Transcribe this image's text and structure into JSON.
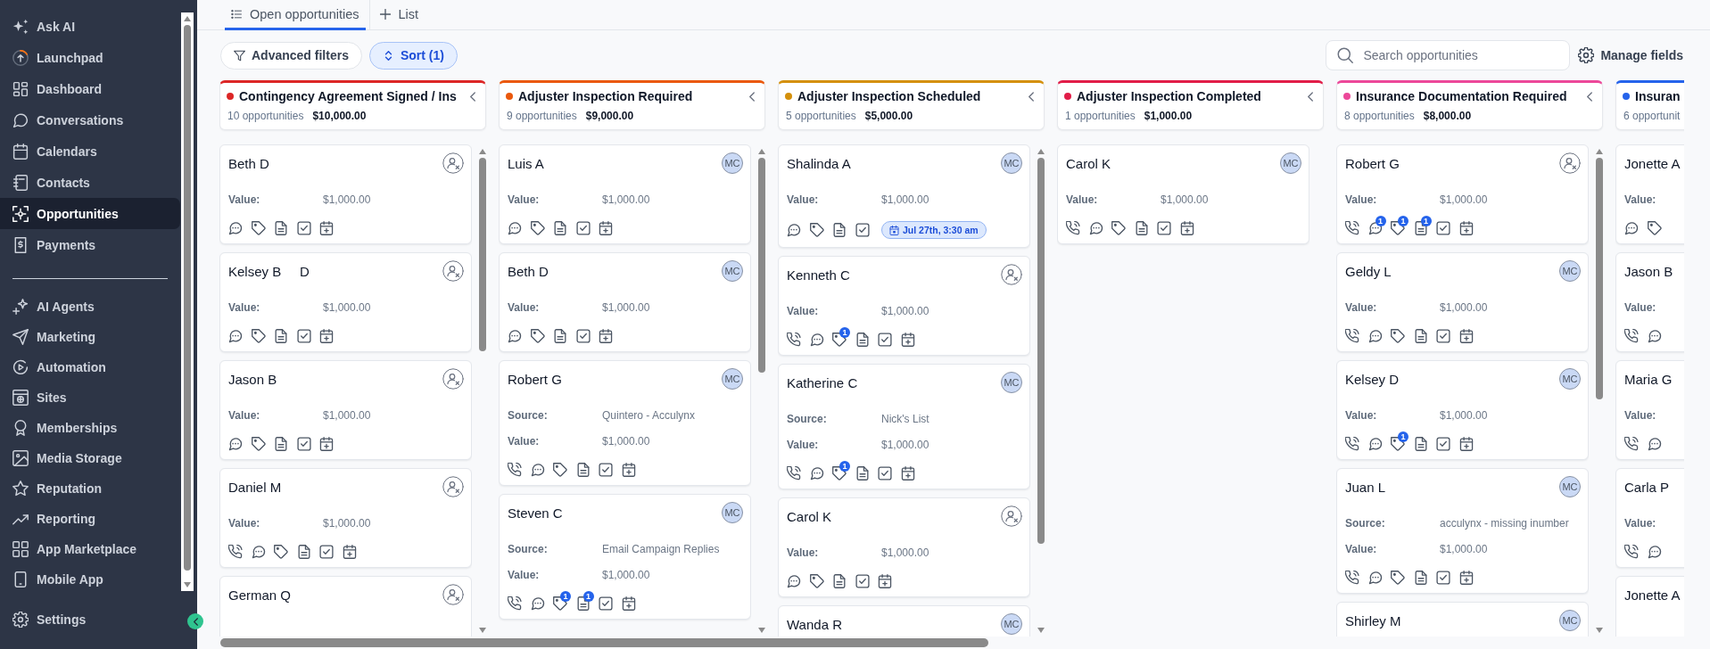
{
  "sidebar": {
    "sections": [
      {
        "items": [
          {
            "label": "Ask AI",
            "kind": "ask_ai",
            "selected": false
          },
          {
            "label": "Launchpad",
            "kind": "launchpad",
            "selected": false
          },
          {
            "label": "Dashboard",
            "kind": "dashboard",
            "selected": false
          },
          {
            "label": "Conversations",
            "kind": "conversations",
            "selected": false
          },
          {
            "label": "Calendars",
            "kind": "calendars",
            "selected": false
          },
          {
            "label": "Contacts",
            "kind": "contacts",
            "selected": false
          },
          {
            "label": "Opportunities",
            "kind": "opportunities",
            "selected": true
          },
          {
            "label": "Payments",
            "kind": "payments",
            "selected": false
          }
        ]
      },
      {
        "items": [
          {
            "label": "AI Agents",
            "kind": "ai_agents",
            "selected": false
          },
          {
            "label": "Marketing",
            "kind": "marketing",
            "selected": false
          },
          {
            "label": "Automation",
            "kind": "automation",
            "selected": false
          },
          {
            "label": "Sites",
            "kind": "sites",
            "selected": false
          },
          {
            "label": "Memberships",
            "kind": "memberships",
            "selected": false
          },
          {
            "label": "Media Storage",
            "kind": "media",
            "selected": false
          },
          {
            "label": "Reputation",
            "kind": "reputation",
            "selected": false
          },
          {
            "label": "Reporting",
            "kind": "reporting",
            "selected": false
          },
          {
            "label": "App Marketplace",
            "kind": "marketplace",
            "selected": false
          },
          {
            "label": "Mobile App",
            "kind": "mobile",
            "selected": false
          }
        ]
      }
    ],
    "footer": {
      "label": "Settings",
      "kind": "settings",
      "selected": false
    }
  },
  "tabs": [
    {
      "label": "Open opportunities",
      "kind": "list",
      "selected": true
    },
    {
      "label": "List",
      "kind": "plus",
      "selected": false
    }
  ],
  "toolbar": {
    "filters": {
      "label": "Advanced filters"
    },
    "sort": {
      "label": "Sort (1)",
      "active": true
    },
    "search": {
      "placeholder": "Search opportunities"
    },
    "manage": {
      "label": "Manage fields"
    }
  },
  "board": {
    "columns": [
      {
        "title": "Contingency Agreement Signed / Ins",
        "color": "#dc2626",
        "count": "10 opportunities",
        "total": "$10,000.00",
        "scrollable": true,
        "cards": [
          {
            "name": "Beth D",
            "owner": {
              "kind": "unassigned"
            },
            "fields": [
              {
                "label": "Value:",
                "value": "$1,000.00"
              }
            ],
            "actions": [
              {
                "kind": "chat"
              },
              {
                "kind": "tag"
              },
              {
                "kind": "note"
              },
              {
                "kind": "task"
              },
              {
                "kind": "appointment"
              }
            ]
          },
          {
            "name": "Kelsey B     D",
            "owner": {
              "kind": "unassigned"
            },
            "fields": [
              {
                "label": "Value:",
                "value": "$1,000.00"
              }
            ],
            "actions": [
              {
                "kind": "chat"
              },
              {
                "kind": "tag"
              },
              {
                "kind": "note"
              },
              {
                "kind": "task"
              },
              {
                "kind": "appointment"
              }
            ]
          },
          {
            "name": "Jason B",
            "owner": {
              "kind": "unassigned"
            },
            "fields": [
              {
                "label": "Value:",
                "value": "$1,000.00"
              }
            ],
            "actions": [
              {
                "kind": "chat"
              },
              {
                "kind": "tag"
              },
              {
                "kind": "note"
              },
              {
                "kind": "task"
              },
              {
                "kind": "appointment"
              }
            ]
          },
          {
            "name": "Daniel M",
            "owner": {
              "kind": "unassigned"
            },
            "fields": [
              {
                "label": "Value:",
                "value": "$1,000.00"
              }
            ],
            "actions": [
              {
                "kind": "call"
              },
              {
                "kind": "chat"
              },
              {
                "kind": "tag"
              },
              {
                "kind": "note"
              },
              {
                "kind": "task"
              },
              {
                "kind": "appointment"
              }
            ]
          },
          {
            "name": "German Q",
            "owner": {
              "kind": "unassigned"
            }
          }
        ]
      },
      {
        "title": "Adjuster Inspection Required",
        "color": "#ea580c",
        "count": "9 opportunities",
        "total": "$9,000.00",
        "scrollable": true,
        "cards": [
          {
            "name": "Luis A",
            "owner": {
              "kind": "initials",
              "initials": "MC"
            },
            "fields": [
              {
                "label": "Value:",
                "value": "$1,000.00"
              }
            ],
            "actions": [
              {
                "kind": "chat"
              },
              {
                "kind": "tag"
              },
              {
                "kind": "note"
              },
              {
                "kind": "task"
              },
              {
                "kind": "appointment"
              }
            ]
          },
          {
            "name": "Beth D",
            "owner": {
              "kind": "initials",
              "initials": "MC"
            },
            "fields": [
              {
                "label": "Value:",
                "value": "$1,000.00"
              }
            ],
            "actions": [
              {
                "kind": "chat"
              },
              {
                "kind": "tag"
              },
              {
                "kind": "note"
              },
              {
                "kind": "task"
              },
              {
                "kind": "appointment"
              }
            ]
          },
          {
            "name": "Robert G",
            "owner": {
              "kind": "initials",
              "initials": "MC"
            },
            "fields": [
              {
                "label": "Source:",
                "value": "Quintero - Acculynx"
              },
              {
                "label": "Value:",
                "value": "$1,000.00"
              }
            ],
            "actions": [
              {
                "kind": "call"
              },
              {
                "kind": "chat"
              },
              {
                "kind": "tag"
              },
              {
                "kind": "note"
              },
              {
                "kind": "task"
              },
              {
                "kind": "appointment"
              }
            ]
          },
          {
            "name": "Steven C",
            "owner": {
              "kind": "initials",
              "initials": "MC"
            },
            "fields": [
              {
                "label": "Source:",
                "value": "Email Campaign Replies"
              },
              {
                "label": "Value:",
                "value": "$1,000.00"
              }
            ],
            "actions": [
              {
                "kind": "call"
              },
              {
                "kind": "chat"
              },
              {
                "kind": "tag",
                "badge": "1"
              },
              {
                "kind": "note",
                "badge": "1"
              },
              {
                "kind": "task"
              },
              {
                "kind": "appointment"
              }
            ]
          }
        ]
      },
      {
        "title": "Adjuster Inspection Scheduled",
        "color": "#d4900b",
        "count": "5 opportunities",
        "total": "$5,000.00",
        "scrollable": true,
        "cards": [
          {
            "name": "Shalinda A",
            "owner": {
              "kind": "initials",
              "initials": "MC"
            },
            "fields": [
              {
                "label": "Value:",
                "value": "$1,000.00"
              }
            ],
            "actions": [
              {
                "kind": "chat"
              },
              {
                "kind": "tag"
              },
              {
                "kind": "note"
              },
              {
                "kind": "task"
              },
              {
                "kind": "appointment",
                "label": "Jul 27th, 3:30 am"
              }
            ]
          },
          {
            "name": "Kenneth C",
            "owner": {
              "kind": "unassigned"
            },
            "fields": [
              {
                "label": "Value:",
                "value": "$1,000.00"
              }
            ],
            "actions": [
              {
                "kind": "call"
              },
              {
                "kind": "chat"
              },
              {
                "kind": "tag",
                "badge": "1"
              },
              {
                "kind": "note"
              },
              {
                "kind": "task"
              },
              {
                "kind": "appointment"
              }
            ]
          },
          {
            "name": "Katherine C",
            "owner": {
              "kind": "initials",
              "initials": "MC"
            },
            "fields": [
              {
                "label": "Source:",
                "value": "Nick's List"
              },
              {
                "label": "Value:",
                "value": "$1,000.00"
              }
            ],
            "actions": [
              {
                "kind": "call"
              },
              {
                "kind": "chat"
              },
              {
                "kind": "tag",
                "badge": "1"
              },
              {
                "kind": "note"
              },
              {
                "kind": "task"
              },
              {
                "kind": "appointment"
              }
            ]
          },
          {
            "name": "Carol K",
            "owner": {
              "kind": "unassigned"
            },
            "fields": [
              {
                "label": "Value:",
                "value": "$1,000.00"
              }
            ],
            "actions": [
              {
                "kind": "chat"
              },
              {
                "kind": "tag"
              },
              {
                "kind": "note"
              },
              {
                "kind": "task"
              },
              {
                "kind": "appointment"
              }
            ]
          },
          {
            "name": "Wanda R",
            "owner": {
              "kind": "initials",
              "initials": "MC"
            }
          }
        ]
      },
      {
        "title": "Adjuster Inspection Completed",
        "color": "#e11d48",
        "count": "1 opportunities",
        "total": "$1,000.00",
        "cards": [
          {
            "name": "Carol K",
            "owner": {
              "kind": "initials",
              "initials": "MC"
            },
            "fields": [
              {
                "label": "Value:",
                "value": "$1,000.00"
              }
            ],
            "actions": [
              {
                "kind": "call"
              },
              {
                "kind": "chat"
              },
              {
                "kind": "tag"
              },
              {
                "kind": "note"
              },
              {
                "kind": "task"
              },
              {
                "kind": "appointment"
              }
            ]
          }
        ]
      },
      {
        "title": "Insurance Documentation Required",
        "color": "#ec4899",
        "count": "8 opportunities",
        "total": "$8,000.00",
        "scrollable": true,
        "cards": [
          {
            "name": "Robert G",
            "owner": {
              "kind": "unassigned"
            },
            "fields": [
              {
                "label": "Value:",
                "value": "$1,000.00"
              }
            ],
            "actions": [
              {
                "kind": "call"
              },
              {
                "kind": "chat",
                "badge": "1"
              },
              {
                "kind": "tag",
                "badge": "1"
              },
              {
                "kind": "note",
                "badge": "1"
              },
              {
                "kind": "task"
              },
              {
                "kind": "appointment"
              }
            ]
          },
          {
            "name": "Geldy L",
            "owner": {
              "kind": "initials",
              "initials": "MC"
            },
            "fields": [
              {
                "label": "Value:",
                "value": "$1,000.00"
              }
            ],
            "actions": [
              {
                "kind": "call"
              },
              {
                "kind": "chat"
              },
              {
                "kind": "tag"
              },
              {
                "kind": "note"
              },
              {
                "kind": "task"
              },
              {
                "kind": "appointment"
              }
            ]
          },
          {
            "name": "Kelsey D",
            "owner": {
              "kind": "initials",
              "initials": "MC"
            },
            "fields": [
              {
                "label": "Value:",
                "value": "$1,000.00"
              }
            ],
            "actions": [
              {
                "kind": "call"
              },
              {
                "kind": "chat"
              },
              {
                "kind": "tag",
                "badge": "1"
              },
              {
                "kind": "note"
              },
              {
                "kind": "task"
              },
              {
                "kind": "appointment"
              }
            ]
          },
          {
            "name": "Juan L",
            "owner": {
              "kind": "initials",
              "initials": "MC"
            },
            "fields": [
              {
                "label": "Source:",
                "value": "acculynx - missing inumber"
              },
              {
                "label": "Value:",
                "value": "$1,000.00"
              }
            ],
            "actions": [
              {
                "kind": "call"
              },
              {
                "kind": "chat"
              },
              {
                "kind": "tag"
              },
              {
                "kind": "note"
              },
              {
                "kind": "task"
              },
              {
                "kind": "appointment"
              }
            ]
          },
          {
            "name": "Shirley M",
            "owner": {
              "kind": "initials",
              "initials": "MC"
            }
          }
        ]
      },
      {
        "title": "Insuran",
        "color": "#2563eb",
        "count": "6 opportunit",
        "cards": [
          {
            "name": "Jonette A",
            "fields": [
              {
                "label": "Value:"
              }
            ],
            "actions": [
              {
                "kind": "chat"
              },
              {
                "kind": "tag"
              }
            ]
          },
          {
            "name": "Jason B",
            "fields": [
              {
                "label": "Value:"
              }
            ],
            "actions": [
              {
                "kind": "call"
              },
              {
                "kind": "chat"
              }
            ]
          },
          {
            "name": "Maria G",
            "fields": [
              {
                "label": "Value:"
              }
            ],
            "actions": [
              {
                "kind": "call"
              },
              {
                "kind": "chat"
              }
            ]
          },
          {
            "name": "Carla P",
            "fields": [
              {
                "label": "Value:"
              }
            ],
            "actions": [
              {
                "kind": "call"
              },
              {
                "kind": "chat"
              }
            ]
          },
          {
            "name": "Jonette A"
          }
        ]
      }
    ]
  }
}
